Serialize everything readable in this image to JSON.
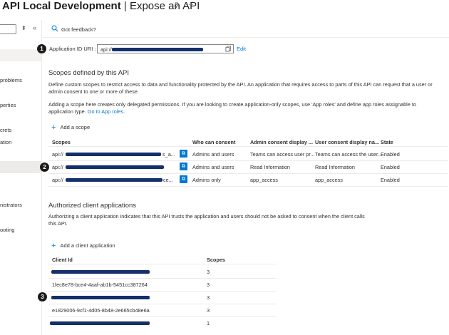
{
  "header": {
    "title_bold": "API Local Development",
    "title_sep": " | ",
    "title_rest": "Expose an API",
    "pin_icon": "pin-icon",
    "more_icon": "more-icon",
    "more": "···"
  },
  "sidebar": {
    "up_down_icon": "updown-icon",
    "up_down": "⬍",
    "collapse_icon": "double-chevron-left-icon",
    "collapse": "«",
    "items": [
      "problems",
      "perties",
      "crets",
      "ation",
      "nistrators",
      "ooting"
    ]
  },
  "toolbar": {
    "feedback_icon": "feedback-icon",
    "feedback_label": "Got feedback?"
  },
  "app_id": {
    "badge": "1",
    "label": "Application ID URI :",
    "value_prefix": "api://",
    "copy_icon": "copy-icon",
    "edit": "Edit"
  },
  "scopes": {
    "heading": "Scopes defined by this API",
    "desc1": "Define custom scopes to restrict access to data and functionality protected by the API. An application that requires access to parts of this API can request that a user or admin consent to one or more of these.",
    "desc2_text": "Adding a scope here creates only delegated permissions. If you are looking to create application-only scopes, use 'App roles' and define app roles assignable to application type.",
    "desc2_link": "Go to App roles.",
    "add_label": "Add a scope",
    "badge": "2",
    "columns": [
      "Scopes",
      "Who can consent",
      "Admin consent display ...",
      "User consent display na...",
      "State"
    ],
    "rows": [
      {
        "scope_prefix": "api://",
        "scope_suffix": "s_a...",
        "who": "Admins and users",
        "admin": "Teams can access user pr...",
        "user": "Teams can access the user...",
        "state": "Enabled"
      },
      {
        "scope_prefix": "api://",
        "scope_suffix": "",
        "who": "Admins and users",
        "admin": "Read Information",
        "user": "Read Information",
        "state": "Enabled"
      },
      {
        "scope_prefix": "api://",
        "scope_suffix": "ce...",
        "who": "Admins only",
        "admin": "app_access",
        "user": "app_access",
        "state": "Enabled"
      }
    ]
  },
  "clients": {
    "heading": "Authorized client applications",
    "desc": "Authorizing a client application indicates that this API trusts the application and users should not be asked to consent when the client calls this API.",
    "add_label": "Add a client application",
    "badge": "3",
    "columns": [
      "Client Id",
      "Scopes"
    ],
    "rows": [
      {
        "id": "",
        "scopes": "3"
      },
      {
        "id": "1fec8e78-bce4-4aaf-ab1b-5451cc387264",
        "scopes": "3"
      },
      {
        "id": "",
        "scopes": "3"
      },
      {
        "id": "e1829006-9cf1-4d05-8b48-2e665cb48e6a",
        "scopes": "3"
      },
      {
        "id": "",
        "scopes": "1"
      }
    ]
  }
}
